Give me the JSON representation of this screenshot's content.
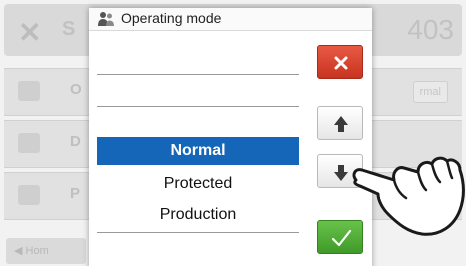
{
  "background": {
    "header_left": "S",
    "header_right": "403",
    "rows": [
      {
        "label": "O",
        "right": "rmal"
      },
      {
        "label": "D",
        "right": ""
      },
      {
        "label": "P",
        "right": ""
      }
    ],
    "home_label": "◀ Hom"
  },
  "dialog": {
    "title": "Operating mode",
    "items": [
      "",
      "",
      "Normal",
      "Protected",
      "Production",
      ""
    ],
    "selected": "Normal",
    "icons": {
      "title": "users-icon",
      "cancel": "close-icon",
      "up": "arrow-up-icon",
      "down": "arrow-down-icon",
      "ok": "checkmark-icon"
    }
  },
  "colors": {
    "selection": "#1565b8",
    "cancel": "#d9432f",
    "confirm": "#4fae36"
  }
}
